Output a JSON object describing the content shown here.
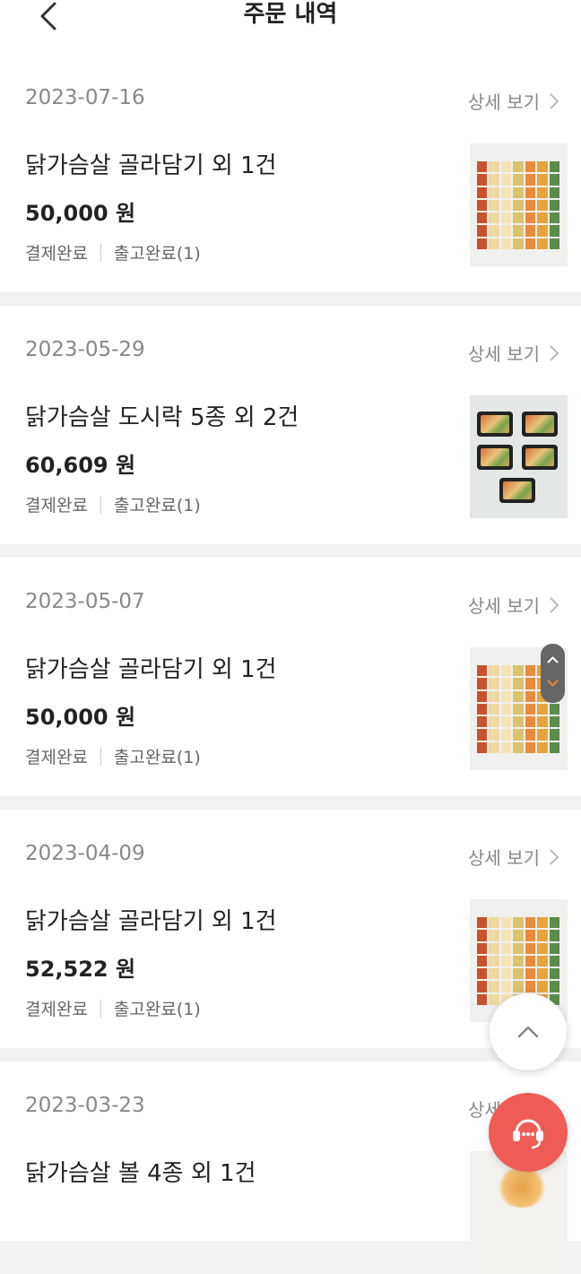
{
  "header": {
    "title": "주문 내역"
  },
  "detail_label": "상세 보기",
  "orders": [
    {
      "date": "2023-07-16",
      "product": "닭가슴살 골라담기 외 1건",
      "price": "50,000 원",
      "payment": "결제완료",
      "shipping": "출고완료(1)",
      "thumb": "assorted-pack"
    },
    {
      "date": "2023-05-29",
      "product": "닭가슴살 도시락 5종 외 2건",
      "price": "60,609 원",
      "payment": "결제완료",
      "shipping": "출고완료(1)",
      "thumb": "lunchbox-set"
    },
    {
      "date": "2023-05-07",
      "product": "닭가슴살 골라담기 외 1건",
      "price": "50,000 원",
      "payment": "결제완료",
      "shipping": "출고완료(1)",
      "thumb": "assorted-pack"
    },
    {
      "date": "2023-04-09",
      "product": "닭가슴살 골라담기 외 1건",
      "price": "52,522 원",
      "payment": "결제완료",
      "shipping": "출고완료(1)",
      "thumb": "assorted-pack"
    },
    {
      "date": "2023-03-23",
      "product": "닭가슴살 볼 4종 외 1건",
      "price": "",
      "payment": "",
      "shipping": "",
      "thumb": "chicken-ball"
    }
  ],
  "colors": {
    "accent": "#ef5c55",
    "text": "#222222",
    "muted": "#888888",
    "divider": "#f2f2f2"
  }
}
